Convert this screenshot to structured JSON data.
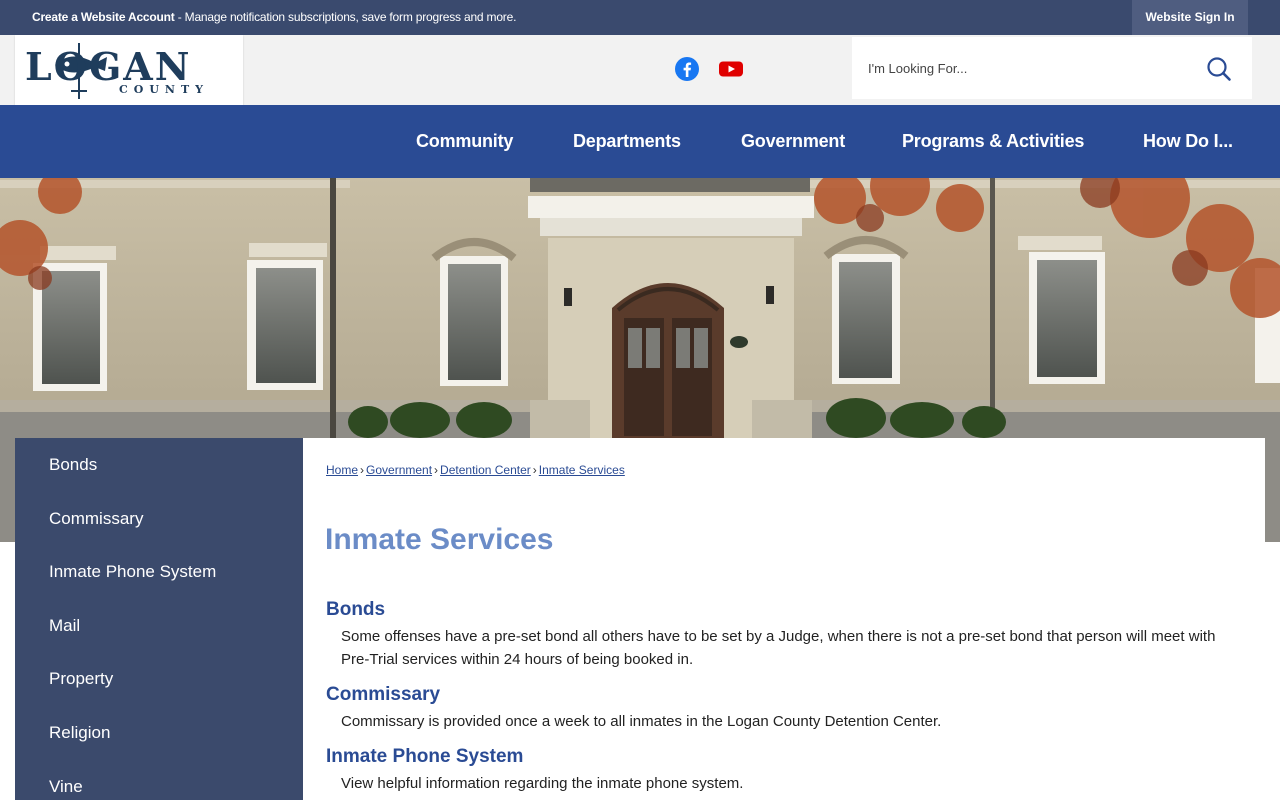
{
  "topbar": {
    "account_link": "Create a Website Account",
    "account_desc": " - Manage notification subscriptions, save form progress and more.",
    "signin": "Website Sign In"
  },
  "header": {
    "logo_line1": "LOGAN",
    "logo_line2": "COUNTY",
    "social": [
      "facebook-icon",
      "youtube-icon"
    ],
    "search": {
      "placeholder": "I'm Looking For..."
    }
  },
  "nav": [
    "Community",
    "Departments",
    "Government",
    "Programs & Activities",
    "How Do I..."
  ],
  "sidebar": [
    "Bonds",
    "Commissary",
    "Inmate Phone System",
    "Mail",
    "Property",
    "Religion",
    "Vine"
  ],
  "breadcrumb": [
    "Home",
    "Government",
    "Detention Center",
    "Inmate Services"
  ],
  "page_title": "Inmate Services",
  "sections": [
    {
      "heading": "Bonds",
      "text": "Some offenses have a pre-set bond all others have to be set by a Judge, when there is not a pre-set bond that person will meet with Pre-Trial services within 24 hours of being booked in."
    },
    {
      "heading": "Commissary",
      "text": "Commissary is provided once a week to all inmates in the Logan County Detention Center."
    },
    {
      "heading": "Inmate Phone System",
      "text": "View helpful information regarding the inmate phone system."
    }
  ],
  "colors": {
    "nav": "#2a4b94",
    "topbar": "#3a4a6e",
    "sidebar": "#3b4a6c",
    "title": "#6b8cc7"
  }
}
